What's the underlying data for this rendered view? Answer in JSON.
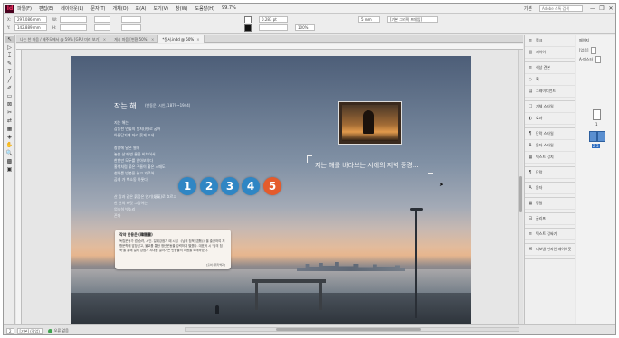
{
  "app": {
    "logo": "Id",
    "menu": [
      "파일(F)",
      "편집(E)",
      "레이아웃(L)",
      "문자(T)",
      "개체(O)",
      "표(A)",
      "보기(V)",
      "창(W)",
      "도움말(H)"
    ],
    "zoom": "99.7%",
    "workspace": "기본",
    "search_placeholder": "Adobe 스톡 검색",
    "win_controls": [
      "—",
      "❐",
      "✕"
    ]
  },
  "control_bar": {
    "x_label": "X:",
    "x_value": "297.086 mm",
    "y_label": "Y:",
    "y_value": "142.889 mm",
    "w_label": "W:",
    "h_label": "H:",
    "stroke_weight": "0.283 pt",
    "opacity": "100%",
    "ref_value": "5 mm",
    "frame_fitting": "[기본 그래픽 프레임]"
  },
  "tabs": [
    {
      "label": "나는 찬 마음 / 제주도에서 @ 59% [GPU 미리 보기]",
      "active": false
    },
    {
      "label": "게시 마음 [변환 50%]",
      "active": false
    },
    {
      "label": "*문서.indd @ 50%",
      "active": true
    }
  ],
  "tools": [
    "↖",
    "▷",
    "⌶",
    "✎",
    "T",
    "╱",
    "✐",
    "▭",
    "⊠",
    "✂",
    "⇄",
    "▦",
    "◈",
    "✋",
    "🔍",
    "▩",
    "▣"
  ],
  "spread": {
    "poem_title": "작는 해",
    "poem_author": "(번동운, 시인, 1879~1944)",
    "stanza1": [
      "지는 해는",
      "감동한 연출의 빛처(光)로 굽어",
      "아름답기에 저리 붉게 뜨네"
    ],
    "stanza2": [
      "창장에 달은 떨어",
      "놓은 산과 번 물을 비치어서",
      "한번만 모두를 안아보이다",
      "홍색처럼 붉은 구름이 흩은 소매도",
      "천하를 빙봉을 놓고 가르어",
      "곱게 가 벽소동 하룻다"
    ],
    "stanza3": [
      "산 강과 같은 붉음은 연기(烟氣)로 흐르고",
      "한 산의 바닷 그렁어는",
      "엄숙히 빗소리",
      "끈다"
    ],
    "numbers": [
      "1",
      "2",
      "3",
      "4",
      "5"
    ],
    "caption": "지는 해를 바라보는 시에의 저녁 풍경…",
    "info_card": {
      "title": "작약 한용운 (韓龍雲)",
      "body": "독립운동가 겸 승려, 시인. 일제강점기 때 시집 《님의 침묵(沈默)》을 출간하여 저항문학에 앞장섰고, 불교를 통한 청년운동을 강력하게 펼쳤다. 대표적 시 '님의 침묵'을 통해 일제 강점기 시대를 살아가는 민중들의 마음을 노래하였다.",
      "source": "[출처: 위키백과]"
    }
  },
  "panel": {
    "groups": [
      [
        {
          "icon": "≡",
          "label": "링크"
        },
        {
          "icon": "▥",
          "label": "레이어"
        }
      ],
      [
        {
          "icon": "≡",
          "label": "색상 견본"
        },
        {
          "icon": "◇",
          "label": "획"
        },
        {
          "icon": "▤",
          "label": "그레이디언트"
        }
      ],
      [
        {
          "icon": "☐",
          "label": "개체 스타일"
        },
        {
          "icon": "◐",
          "label": "효과"
        }
      ],
      [
        {
          "icon": "¶",
          "label": "단락 스타일"
        },
        {
          "icon": "A",
          "label": "문자 스타일"
        },
        {
          "icon": "▦",
          "label": "텍스트 감지"
        }
      ],
      [
        {
          "icon": "¶",
          "label": "단락"
        }
      ],
      [
        {
          "icon": "A",
          "label": "문자"
        }
      ],
      [
        {
          "icon": "▦",
          "label": "정렬"
        }
      ],
      [
        {
          "icon": "⊟",
          "label": "글리프"
        }
      ],
      [
        {
          "icon": "≡",
          "label": "텍스트 감싸기"
        }
      ],
      [
        {
          "icon": "⌘",
          "label": "내보낼 인라인 레이아웃"
        }
      ]
    ]
  },
  "pages_panel": {
    "header": "페이지",
    "none_label": "[없음]",
    "master_label": "A-마스터",
    "page_1": "1",
    "page_2_3": "2-3"
  },
  "status": {
    "page_field": "2",
    "preflight": "오류 없음",
    "mode": "[기본] (작업)"
  }
}
